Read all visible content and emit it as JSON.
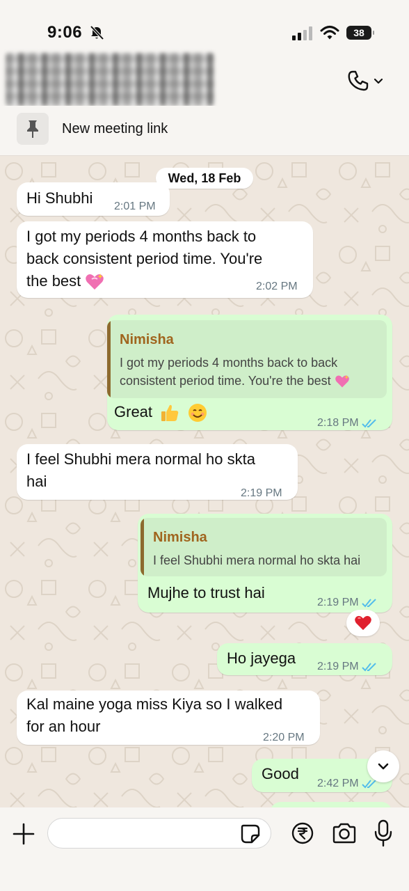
{
  "status_bar": {
    "time": "9:06",
    "battery": "38"
  },
  "pinned": {
    "text": "New meeting link"
  },
  "chat": {
    "date": "Wed, 18 Feb",
    "messages": [
      {
        "type": "in",
        "text": "Hi Shubhi",
        "time": "2:01 PM"
      },
      {
        "type": "in",
        "lines": [
          "I got my periods 4 months back to",
          "back consistent period time. You're",
          "the best"
        ],
        "time": "2:02 PM"
      },
      {
        "type": "out",
        "quote_author": "Nimisha",
        "quote_lines": [
          "I got my periods 4 months back to back",
          "consistent period time. You're the best"
        ],
        "text": "Great",
        "time": "2:18 PM"
      },
      {
        "type": "in",
        "lines": [
          "I feel Shubhi mera normal ho skta",
          "hai"
        ],
        "time": "2:19 PM"
      },
      {
        "type": "out",
        "quote_author": "Nimisha",
        "quote_text": "I feel Shubhi mera normal ho skta hai",
        "text": "Mujhe to trust hai",
        "time": "2:19 PM",
        "reaction": "heart"
      },
      {
        "type": "out",
        "text": "Ho jayega",
        "time": "2:19 PM"
      },
      {
        "type": "in",
        "lines": [
          "Kal maine yoga miss Kiya so I walked",
          "for an hour"
        ],
        "time": "2:20 PM"
      },
      {
        "type": "out",
        "text": "Good",
        "time": "2:42 PM"
      }
    ]
  },
  "icons": {
    "call": "phone-icon",
    "pin": "pin-icon",
    "add": "plus-icon",
    "sticker": "sticker-icon",
    "payment": "rupee-icon",
    "camera": "camera-icon",
    "mic": "microphone-icon"
  },
  "colors": {
    "outgoing_bubble": "#d9fdd3",
    "incoming_bubble": "#ffffff",
    "chat_bg": "#efe7de",
    "read_ticks": "#53bdeb",
    "quote_author": "#a0651e"
  }
}
